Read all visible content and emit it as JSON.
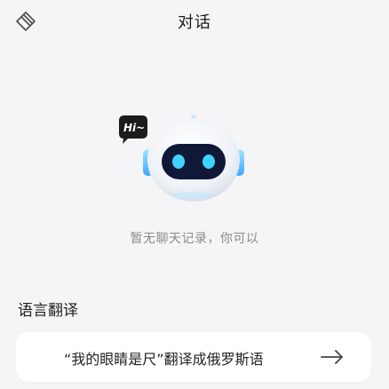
{
  "header": {
    "title": "对话",
    "clear_icon": "erase-icon"
  },
  "empty_state": {
    "bubble_text": "Hi~",
    "hint": "暂无聊天记录，你可以",
    "mascot_icon": "robot-icon"
  },
  "suggestions": {
    "section_label": "语言翻译",
    "items": [
      {
        "text": "“我的眼睛是尺”翻译成俄罗斯语",
        "icon": "arrow-right-icon"
      }
    ]
  },
  "colors": {
    "background": "#f5f5f7",
    "card": "#ffffff",
    "robot_eye": "#3fd3ff",
    "robot_accent": "#6ecbff",
    "hint_text": "#8a8a8a"
  }
}
